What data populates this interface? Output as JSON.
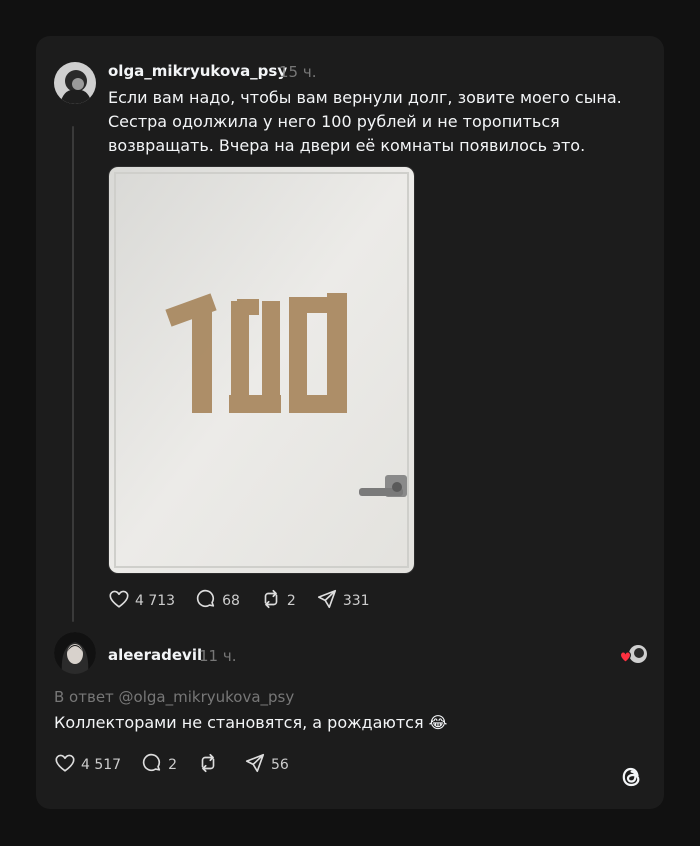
{
  "post": {
    "username": "olga_mikryukova_psy",
    "time": "15 ч.",
    "text": "Если вам надо, чтобы вам вернули долг, зовите моего сына. Сестра одолжила у него 100 рублей и не торопиться возвращать. Вчера на двери её комнаты появилось это.",
    "photo_text": "100",
    "likes": "4 713",
    "comments": "68",
    "reposts": "2",
    "shares": "331"
  },
  "reply": {
    "username": "aleeradevil",
    "time": "11 ч.",
    "reply_to": "В ответ @olga_mikryukova_psy",
    "text": "Коллекторами не становятся, а рождаются 😂",
    "likes": "4 517",
    "comments": "2",
    "reposts": "",
    "shares": "56"
  },
  "icons": {
    "like": "heart-icon",
    "comment": "comment-icon",
    "repost": "repost-icon",
    "share": "share-icon",
    "brand": "threads-logo"
  },
  "colors": {
    "background": "#111111",
    "card": "#1c1c1c",
    "text": "#f3f5f7",
    "muted": "#777777",
    "like_heart": "#ff3040"
  }
}
